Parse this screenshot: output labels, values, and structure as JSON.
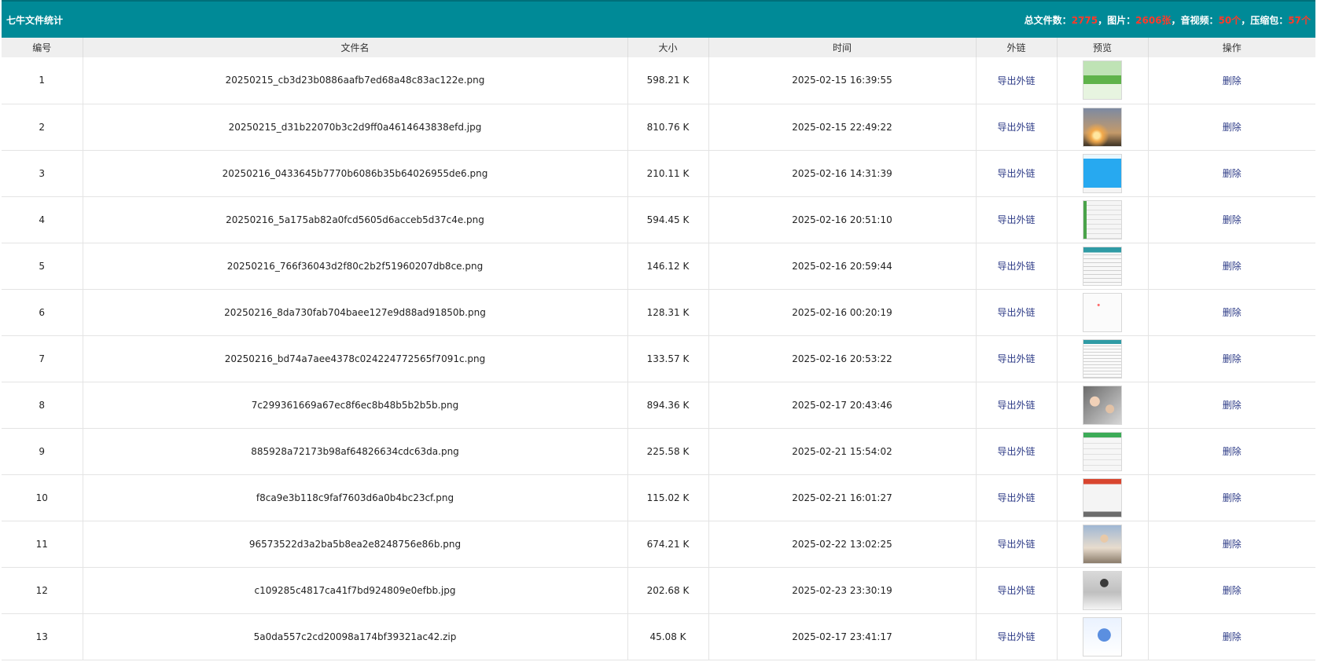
{
  "header": {
    "title": "七牛文件统计",
    "stats": {
      "total_label": "总文件数：",
      "total_value": "2775",
      "sep1": "，",
      "images_label": "图片：",
      "images_value": "2606张",
      "sep2": "，",
      "media_label": "音视频：",
      "media_value": "50个",
      "sep3": "，",
      "archives_label": "压缩包：",
      "archives_value": "57个"
    }
  },
  "columns": [
    "编号",
    "文件名",
    "大小",
    "时间",
    "外链",
    "预览",
    "操作"
  ],
  "rows": [
    {
      "id": "1",
      "name": "20250215_cb3d23b0886aafb7ed68a48c83ac122e.png",
      "size": "598.21 K",
      "time": "2025-02-15 16:39:55",
      "link": "导出外链",
      "thumb": "t-green",
      "action": "删除"
    },
    {
      "id": "2",
      "name": "20250215_d31b22070b3c2d9ff0a4614643838efd.jpg",
      "size": "810.76 K",
      "time": "2025-02-15 22:49:22",
      "link": "导出外链",
      "thumb": "t-tree",
      "action": "删除"
    },
    {
      "id": "3",
      "name": "20250216_0433645b7770b6086b35b64026955de6.png",
      "size": "210.11 K",
      "time": "2025-02-16 14:31:39",
      "link": "导出外链",
      "thumb": "t-blue",
      "action": "删除"
    },
    {
      "id": "4",
      "name": "20250216_5a175ab82a0fcd5605d6acceb5d37c4e.png",
      "size": "594.45 K",
      "time": "2025-02-16 20:51:10",
      "link": "导出外链",
      "thumb": "t-gray1",
      "action": "删除"
    },
    {
      "id": "5",
      "name": "20250216_766f36043d2f80c2b2f51960207db8ce.png",
      "size": "146.12 K",
      "time": "2025-02-16 20:59:44",
      "link": "导出外链",
      "thumb": "t-gray2",
      "action": "删除"
    },
    {
      "id": "6",
      "name": "20250216_8da730fab704baee127e9d88ad91850b.png",
      "size": "128.31 K",
      "time": "2025-02-16 00:20:19",
      "link": "导出外链",
      "thumb": "t-white",
      "action": "删除"
    },
    {
      "id": "7",
      "name": "20250216_bd74a7aee4378c024224772565f7091c.png",
      "size": "133.57 K",
      "time": "2025-02-16 20:53:22",
      "link": "导出外链",
      "thumb": "t-gray3",
      "action": "删除"
    },
    {
      "id": "8",
      "name": "7c299361669a67ec8f6ec8b48b5b2b5b.png",
      "size": "894.36 K",
      "time": "2025-02-17 20:43:46",
      "link": "导出外链",
      "thumb": "t-photo",
      "action": "删除"
    },
    {
      "id": "9",
      "name": "885928a72173b98af64826634cdc63da.png",
      "size": "225.58 K",
      "time": "2025-02-21 15:54:02",
      "link": "导出外链",
      "thumb": "t-chat",
      "action": "删除"
    },
    {
      "id": "10",
      "name": "f8ca9e3b118c9faf7603d6a0b4bc23cf.png",
      "size": "115.02 K",
      "time": "2025-02-21 16:01:27",
      "link": "导出外链",
      "thumb": "t-red",
      "action": "删除"
    },
    {
      "id": "11",
      "name": "96573522d3a2ba5b8ea2e8248756e86b.png",
      "size": "674.21 K",
      "time": "2025-02-22 13:02:25",
      "link": "导出外链",
      "thumb": "t-woman",
      "action": "删除"
    },
    {
      "id": "12",
      "name": "c109285c4817ca41f7bd924809e0efbb.jpg",
      "size": "202.68 K",
      "time": "2025-02-23 23:30:19",
      "link": "导出外链",
      "thumb": "t-coat",
      "action": "删除"
    },
    {
      "id": "13",
      "name": "5a0da557c2cd20098a174bf39321ac42.zip",
      "size": "45.08 K",
      "time": "2025-02-17 23:41:17",
      "link": "导出外链",
      "thumb": "t-zip",
      "action": "删除"
    }
  ]
}
